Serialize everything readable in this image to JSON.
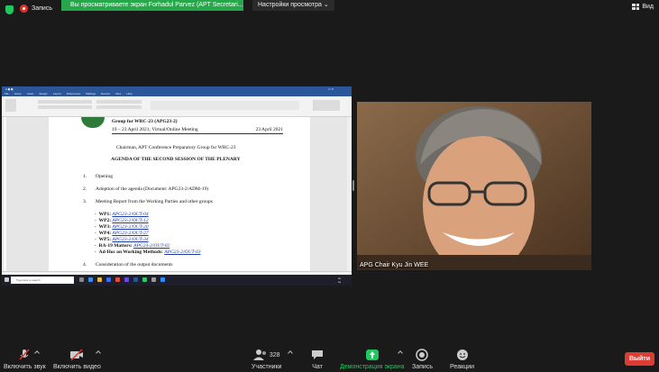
{
  "top": {
    "recording_label": "Запись",
    "share_banner": "Вы просматриваете экран Forhadul Parvez (APT Secretari...",
    "view_options": "Настройки просмотра",
    "view_label": "Вид"
  },
  "document": {
    "header_line1": "Group for WRC-23 (APG23-2)",
    "header_line2": "19 – 23 April 2021, Virtual/Online Meeting",
    "header_date": "23 April 2021",
    "chairman": "Chairman, APT Conference Preparatory Group for WRC-23",
    "agenda_title": "AGENDA OF THE SECOND SESSION OF THE PLENARY",
    "items": [
      {
        "num": "1.",
        "text": "Opening"
      },
      {
        "num": "2.",
        "text": "Adoption of the agenda (Document: APG23-2/ADM-19)"
      },
      {
        "num": "3.",
        "text": "Meeting Report from the Working Parties and other groups"
      },
      {
        "num": "4.",
        "text": "Consideration of the output documents"
      }
    ],
    "subitems": [
      {
        "label": "WP1:",
        "link": "APG23-2/OUT-04"
      },
      {
        "label": "WP2:",
        "link": "APG23-2/OUT-12"
      },
      {
        "label": "WP3:",
        "link": "APG23-2/OUT-20"
      },
      {
        "label": "WP4:",
        "link": "APG23-2/OUT-27"
      },
      {
        "label": "WP5:",
        "link": "APG23-2/OUT-34"
      },
      {
        "label": "RA-19 Matters:",
        "link": "APG23-2/OUT-02"
      },
      {
        "label": "Ad-Hoc on Working Methods:",
        "link": "APG23-2/OUT-03"
      }
    ],
    "search_placeholder": "Type here to search"
  },
  "video": {
    "participant_name": "APG Chair Kyu Jin WEE"
  },
  "toolbar": {
    "unmute": "Включить звук",
    "start_video": "Включить видео",
    "participants": "Участники",
    "participants_count": "328",
    "chat": "Чат",
    "share_screen": "Демонстрация экрана",
    "record": "Запись",
    "reactions": "Реакции",
    "leave": "Выйти"
  },
  "colors": {
    "banner_green": "#26a84a",
    "leave_red": "#dd3b33",
    "word_blue": "#2b579a"
  }
}
